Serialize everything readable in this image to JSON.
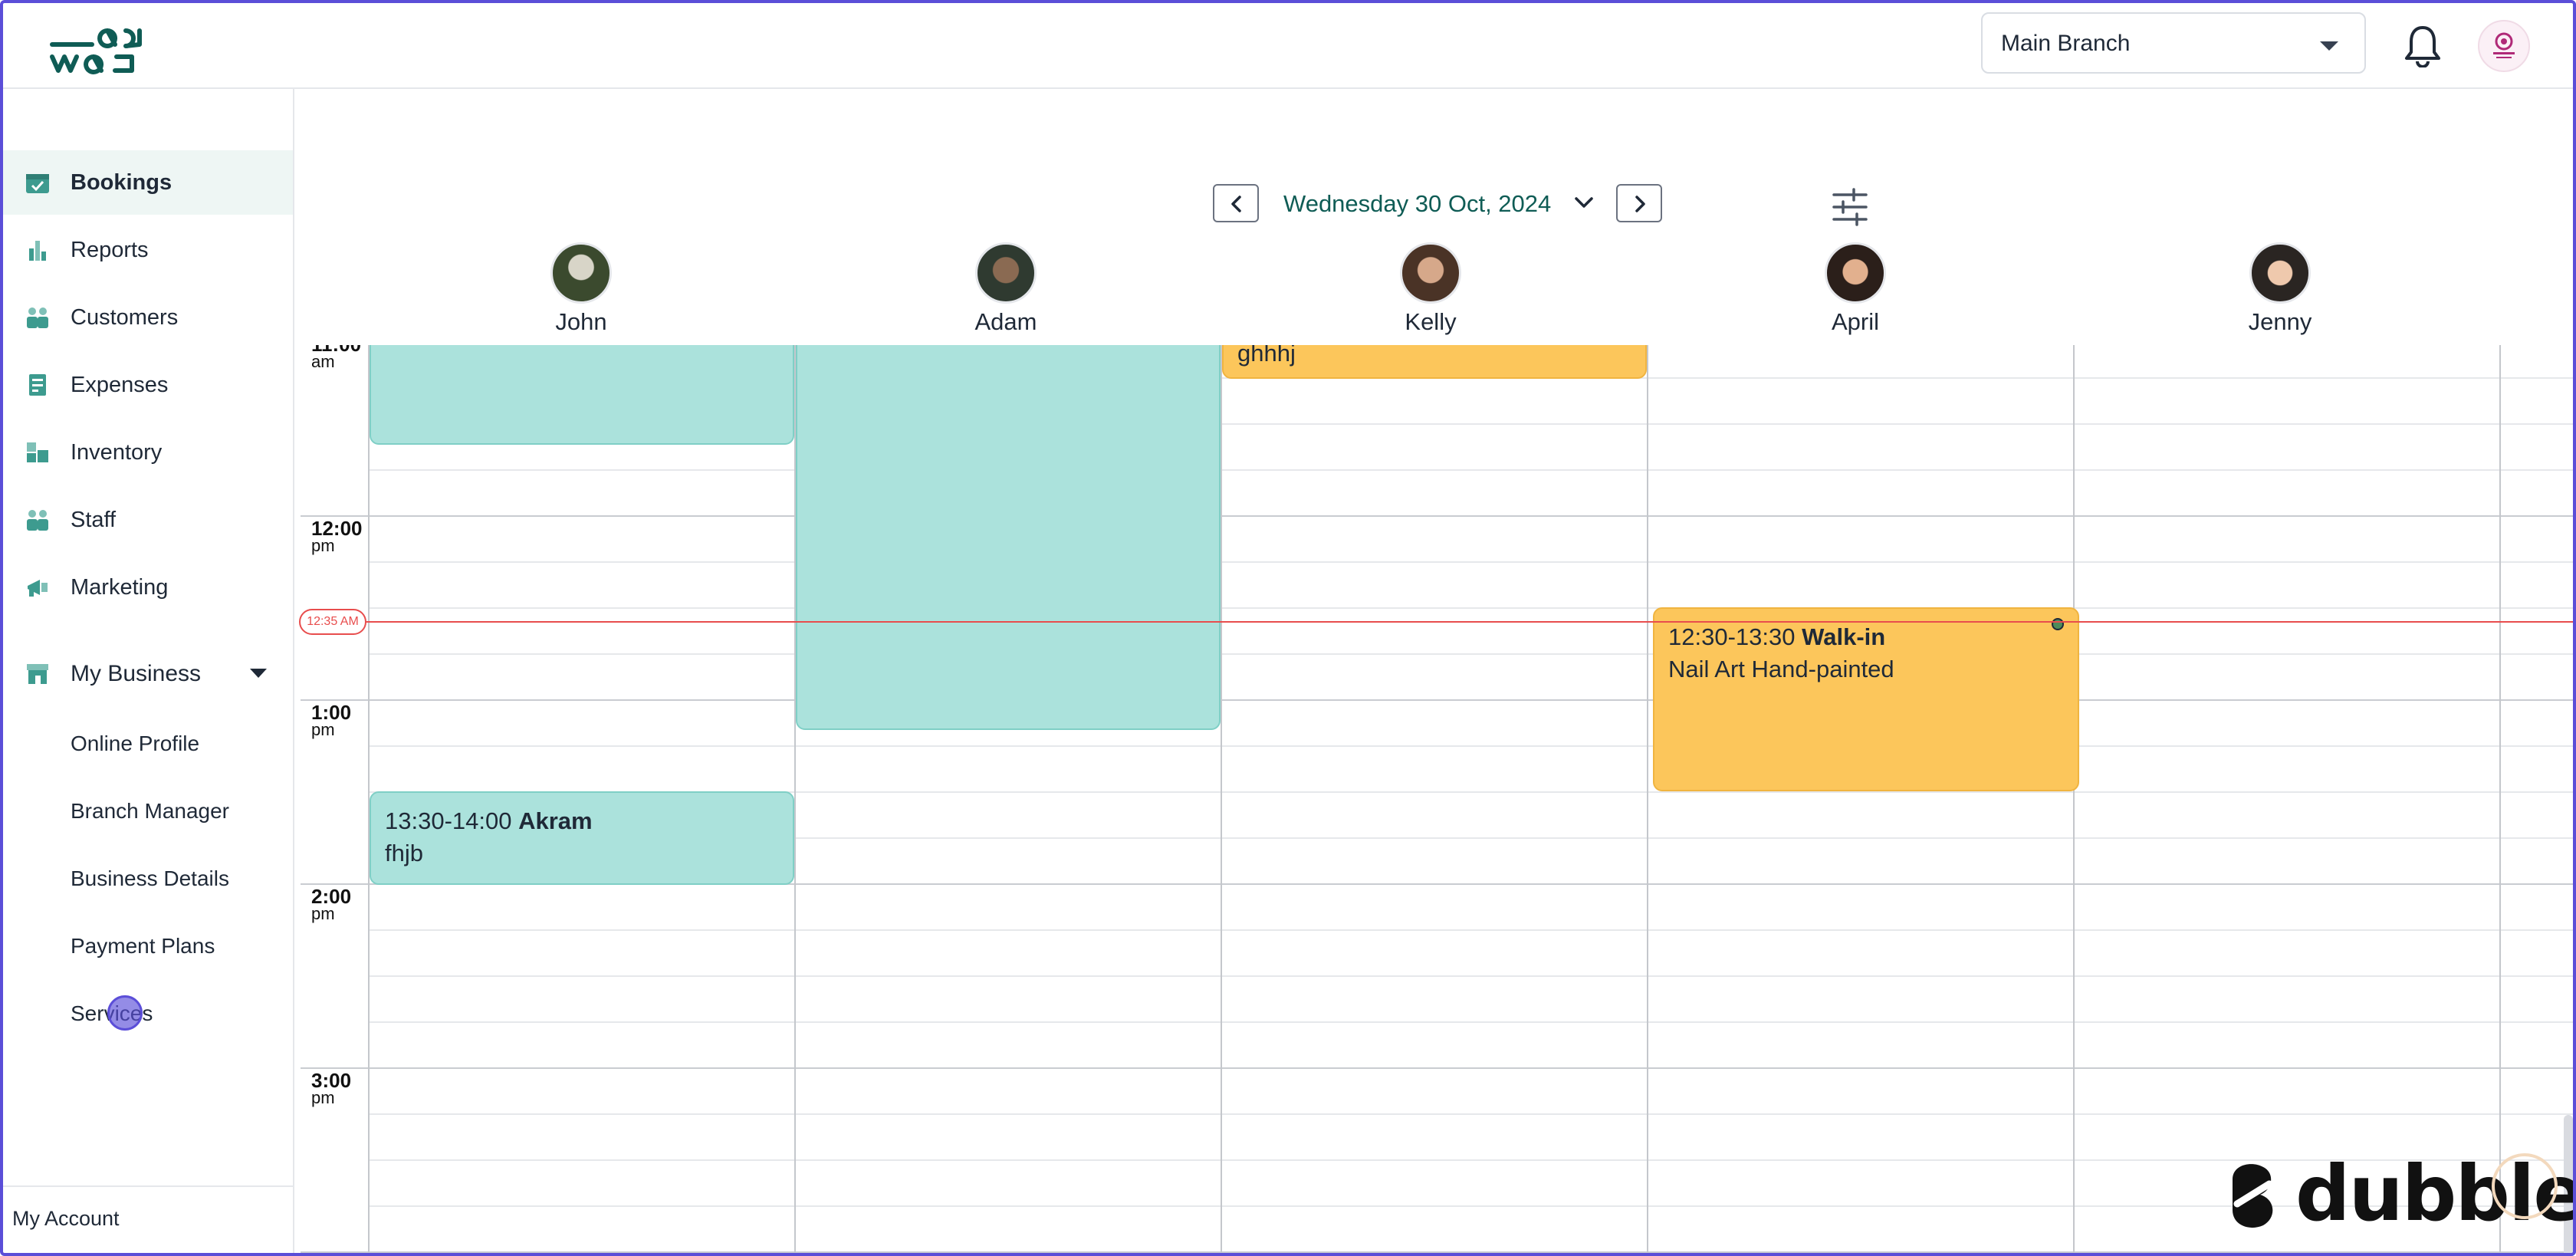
{
  "header": {
    "branch": "Main Branch"
  },
  "sidebar": {
    "items": [
      {
        "label": "Bookings",
        "icon": "calendar-check-icon",
        "active": true
      },
      {
        "label": "Reports",
        "icon": "bar-chart-icon"
      },
      {
        "label": "Customers",
        "icon": "people-icon"
      },
      {
        "label": "Expenses",
        "icon": "receipt-icon"
      },
      {
        "label": "Inventory",
        "icon": "boxes-icon"
      },
      {
        "label": "Staff",
        "icon": "staff-icon"
      },
      {
        "label": "Marketing",
        "icon": "megaphone-icon"
      }
    ],
    "business": {
      "label": "My Business",
      "sub_items": [
        "Online Profile",
        "Branch Manager",
        "Business Details",
        "Payment Plans",
        "Services"
      ]
    },
    "account_label": "My Account"
  },
  "calendar": {
    "date": "Wednesday 30 Oct, 2024",
    "now_label": "12:35 AM",
    "staff": [
      "John",
      "Adam",
      "Kelly",
      "April",
      "Jenny"
    ],
    "hours": [
      {
        "main": "11:00",
        "sub": "am"
      },
      {
        "main": "12:00",
        "sub": "pm"
      },
      {
        "main": "1:00",
        "sub": "pm"
      },
      {
        "main": "2:00",
        "sub": "pm"
      },
      {
        "main": "3:00",
        "sub": "pm"
      }
    ],
    "appointments": [
      {
        "staff": "Kelly",
        "time": "",
        "client": "",
        "service": "ghhhj",
        "color": "#fcc65b"
      },
      {
        "staff": "April",
        "time": "12:30-13:30",
        "client": "Walk-in",
        "service": "Nail Art Hand-painted",
        "color": "#fcc65b"
      },
      {
        "staff": "John",
        "time": "13:30-14:00",
        "client": "Akram",
        "service": "fhjb",
        "color": "#abe2dc"
      }
    ]
  },
  "colors": {
    "accent": "#0f5c55",
    "teal_booking": "#abe2dc",
    "orange_booking": "#fcc65b",
    "now_line": "#e84d4d",
    "frame": "#5b4ed8"
  },
  "watermark": "dubble"
}
